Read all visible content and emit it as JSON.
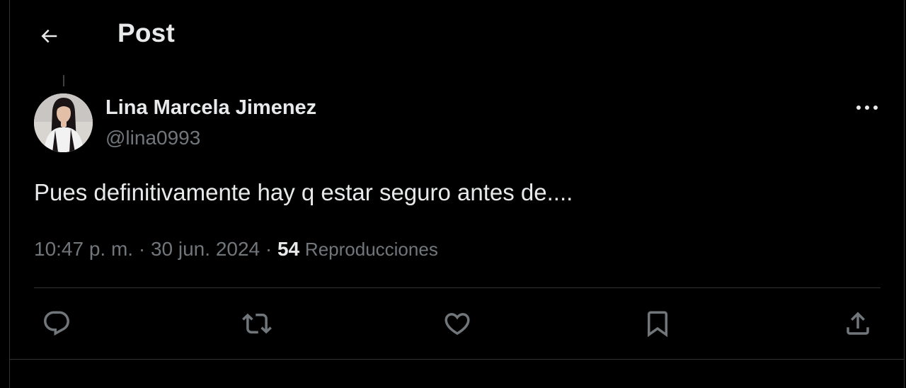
{
  "header": {
    "back_icon": "arrow-left-icon",
    "title": "Post"
  },
  "post": {
    "author": {
      "display_name": "Lina Marcela Jimenez",
      "handle": "@lina0993",
      "avatar_icon": "avatar-photo"
    },
    "more_icon": "ellipsis-icon",
    "text": "Pues definitivamente hay q estar seguro antes de....",
    "timestamp": "10:47 p. m. · 30 jun. 2024 · ",
    "views_count": "54",
    "views_label": "Reproducciones"
  },
  "actions": {
    "reply_icon": "reply-icon",
    "repost_icon": "repost-icon",
    "like_icon": "heart-icon",
    "bookmark_icon": "bookmark-icon",
    "share_icon": "share-icon"
  },
  "colors": {
    "background": "#000000",
    "text_primary": "#e7e9ea",
    "text_secondary": "#71767b",
    "border": "#2f3336"
  }
}
